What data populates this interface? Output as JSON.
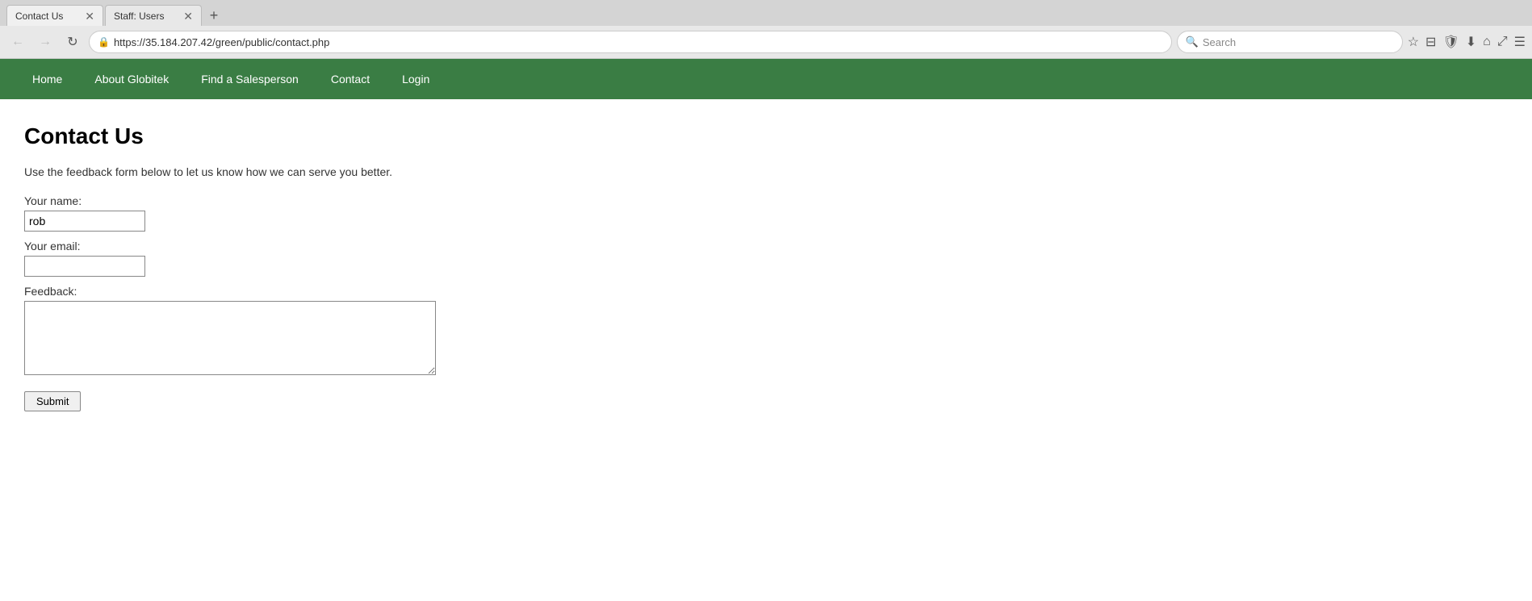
{
  "browser": {
    "tabs": [
      {
        "id": "tab-contact",
        "title": "Contact Us",
        "active": false
      },
      {
        "id": "tab-staff-users",
        "title": "Staff: Users",
        "active": true
      }
    ],
    "new_tab_label": "+",
    "url": "https://35.184.207.42/green/public/contact.php",
    "search_placeholder": "Search",
    "nav_back_label": "←",
    "nav_forward_label": "→",
    "refresh_label": "↻"
  },
  "toolbar": {
    "star_icon": "☆",
    "bookmark_icon": "⊟",
    "shield_icon": "🛡",
    "download_icon": "⬇",
    "home_icon": "⌂",
    "expand_icon": "⤢",
    "menu_icon": "☰"
  },
  "nav": {
    "items": [
      {
        "label": "Home",
        "id": "nav-home"
      },
      {
        "label": "About Globitek",
        "id": "nav-about"
      },
      {
        "label": "Find a Salesperson",
        "id": "nav-salesperson"
      },
      {
        "label": "Contact",
        "id": "nav-contact"
      },
      {
        "label": "Login",
        "id": "nav-login"
      }
    ]
  },
  "page": {
    "title": "Contact Us",
    "description": "Use the feedback form below to let us know how we can serve you better.",
    "form": {
      "name_label": "Your name:",
      "name_value": "rob",
      "email_label": "Your email:",
      "email_value": "",
      "feedback_label": "Feedback:",
      "feedback_value": "",
      "submit_label": "Submit"
    }
  }
}
